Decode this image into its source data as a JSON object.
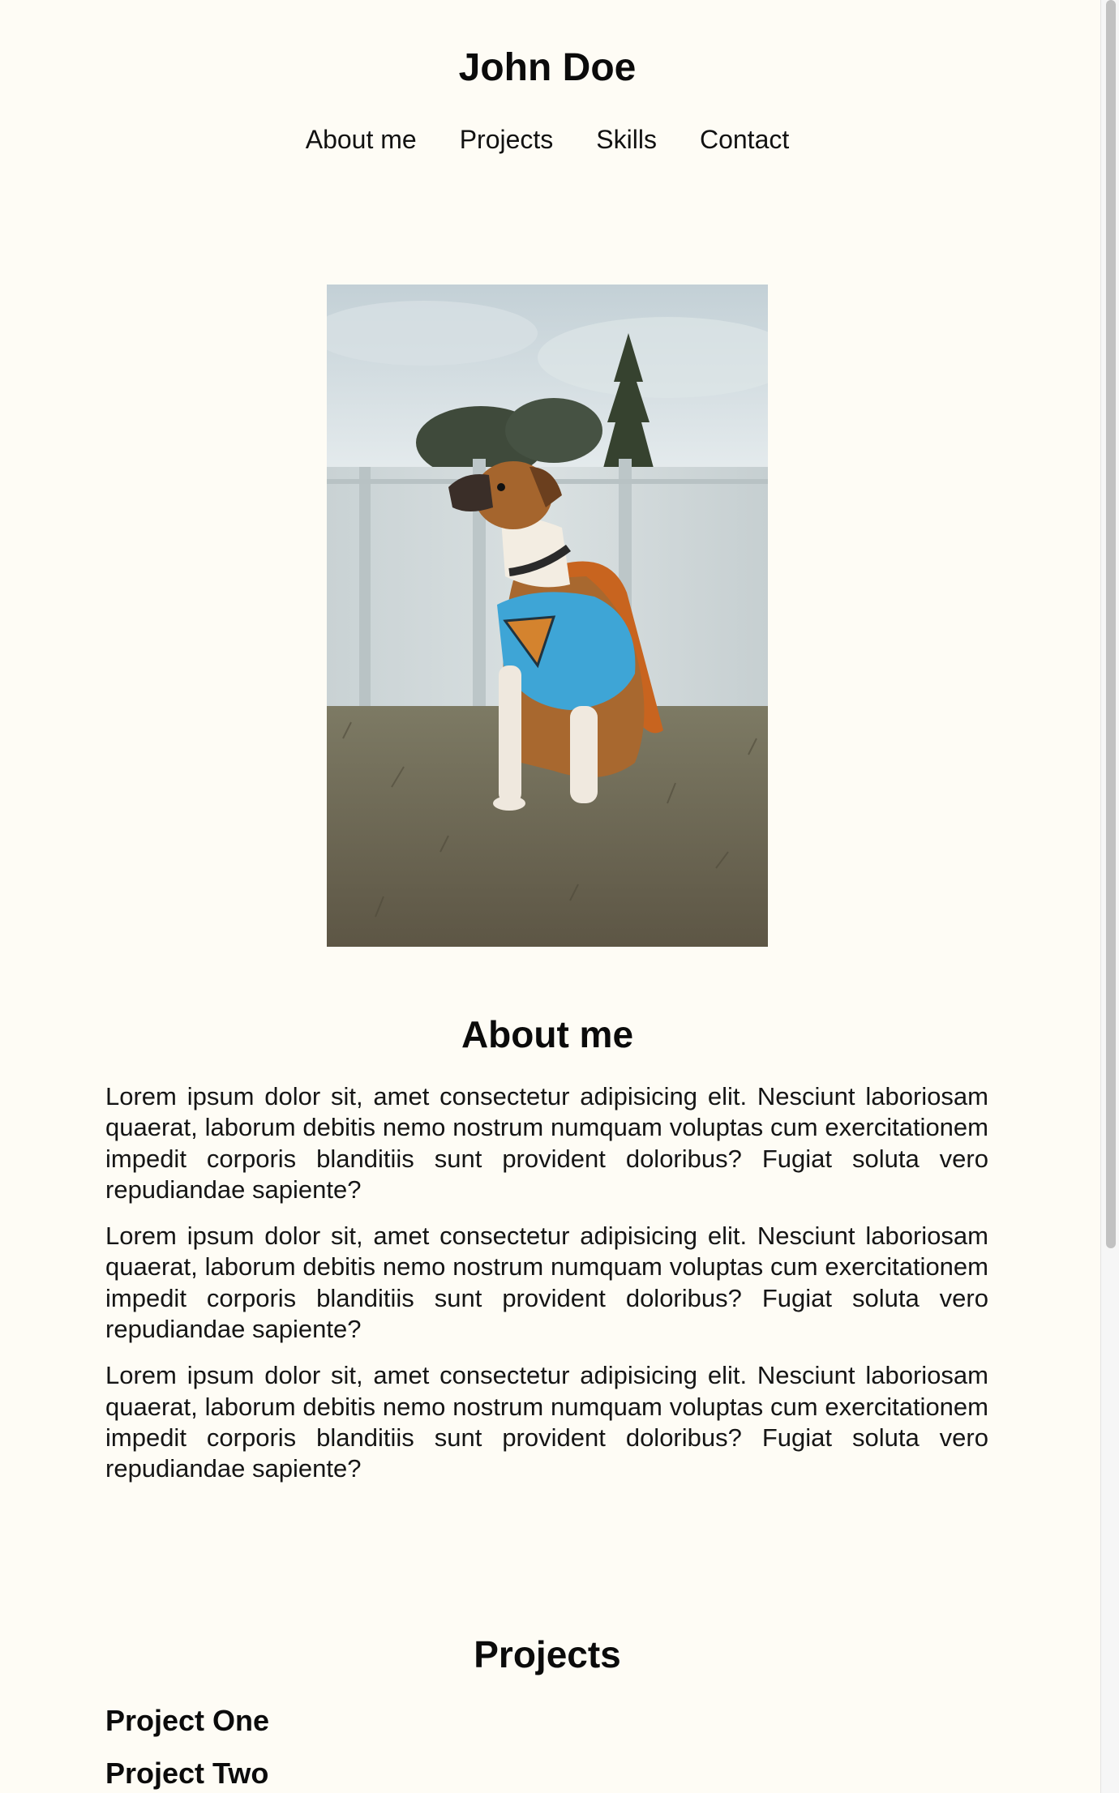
{
  "header": {
    "title": "John Doe"
  },
  "nav": {
    "items": [
      {
        "label": "About me"
      },
      {
        "label": "Projects"
      },
      {
        "label": "Skills"
      },
      {
        "label": "Contact"
      }
    ]
  },
  "hero": {
    "image": "dog-in-superman-costume-photo"
  },
  "about": {
    "heading": "About me",
    "paragraphs": [
      "Lorem ipsum dolor sit, amet consectetur adipisicing elit. Nesciunt laboriosam quaerat, laborum debitis nemo nostrum numquam voluptas cum exercitationem impedit corporis blanditiis sunt provident doloribus? Fugiat soluta vero repudiandae sapiente?",
      "Lorem ipsum dolor sit, amet consectetur adipisicing elit. Nesciunt laboriosam quaerat, laborum debitis nemo nostrum numquam voluptas cum exercitationem impedit corporis blanditiis sunt provident doloribus? Fugiat soluta vero repudiandae sapiente?",
      "Lorem ipsum dolor sit, amet consectetur adipisicing elit. Nesciunt laboriosam quaerat, laborum debitis nemo nostrum numquam voluptas cum exercitationem impedit corporis blanditiis sunt provident doloribus? Fugiat soluta vero repudiandae sapiente?"
    ]
  },
  "projects": {
    "heading": "Projects",
    "items": [
      {
        "title": "Project One"
      },
      {
        "title": "Project Two"
      }
    ]
  },
  "colors": {
    "background": "#fefcf5",
    "text": "#111111"
  }
}
